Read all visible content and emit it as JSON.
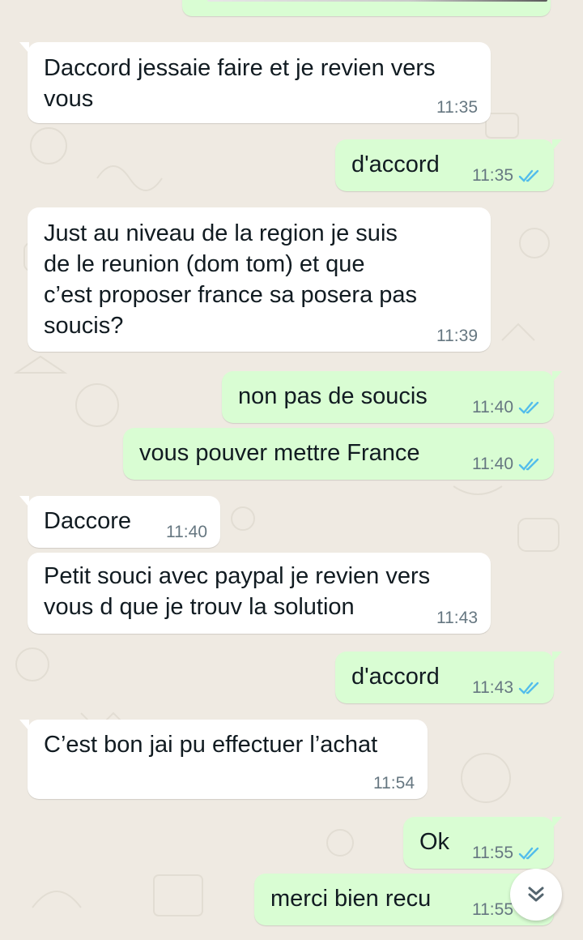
{
  "colors": {
    "background": "#efeae2",
    "incoming_bubble": "#ffffff",
    "outgoing_bubble": "#d9fdd3",
    "timestamp": "#667781",
    "read_ticks": "#53bdeb"
  },
  "messages": [
    {
      "direction": "in",
      "lines": [
        "Daccord jessaie faire et je revien vers",
        "vous"
      ],
      "time": "11:35"
    },
    {
      "direction": "out",
      "lines": [
        "d'accord"
      ],
      "time": "11:35",
      "status_icon": "double-check-icon"
    },
    {
      "direction": "in",
      "lines": [
        "Just au niveau de la region je suis",
        "de le reunion (dom tom) et que",
        "c’est proposer france sa posera pas",
        "soucis?"
      ],
      "time": "11:39"
    },
    {
      "direction": "out",
      "lines": [
        "non pas de soucis"
      ],
      "time": "11:40",
      "status_icon": "double-check-icon"
    },
    {
      "direction": "out",
      "lines": [
        "vous pouver mettre France"
      ],
      "time": "11:40",
      "status_icon": "double-check-icon"
    },
    {
      "direction": "in",
      "lines": [
        "Daccore"
      ],
      "time": "11:40"
    },
    {
      "direction": "in",
      "lines": [
        "Petit souci avec paypal je revien vers",
        "vous d que je trouv la solution"
      ],
      "time": "11:43"
    },
    {
      "direction": "out",
      "lines": [
        "d'accord"
      ],
      "time": "11:43",
      "status_icon": "double-check-icon"
    },
    {
      "direction": "in",
      "lines": [
        "C’est bon jai pu effectuer l’achat"
      ],
      "time": "11:54"
    },
    {
      "direction": "out",
      "lines": [
        "Ok"
      ],
      "time": "11:55",
      "status_icon": "double-check-icon"
    },
    {
      "direction": "out",
      "lines": [
        "merci bien recu"
      ],
      "time": "11:55",
      "status_icon": "double-check-icon"
    }
  ],
  "scroll_button": {
    "icon": "double-chevron-down-icon"
  }
}
